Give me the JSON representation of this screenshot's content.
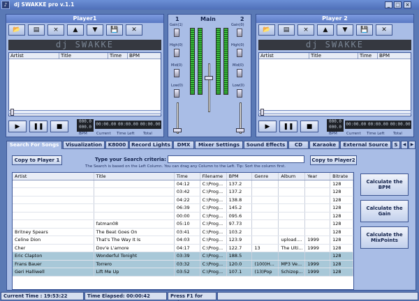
{
  "window": {
    "title": "dj SWAKKE pro   v.1.1"
  },
  "player1": {
    "title": "Player1",
    "display": "dj SWAKKE",
    "columns": [
      "Artist",
      "Title",
      "Time",
      "BPM"
    ],
    "bpm_top": "000.0",
    "bpm_bottom": "000.0",
    "current": "00:00.00",
    "time_left": "00:00.00",
    "total": "00:00.00",
    "bpm_label": "BPM",
    "current_label": "Current",
    "time_left_label": "Time Left",
    "total_label": "Total"
  },
  "player2": {
    "title": "Player 2",
    "display": "dj SWAKKE",
    "columns": [
      "Artist",
      "Title",
      "Time",
      "BPM"
    ],
    "bpm_top": "000.0",
    "bpm_bottom": "000.0",
    "current": "00:00.00",
    "time_left": "00:00.00",
    "total": "00:00.00",
    "bpm_label": "BPM",
    "current_label": "Current",
    "time_left_label": "Time Left",
    "total_label": "Total"
  },
  "mixer": {
    "title": "Main",
    "left_num": "1",
    "right_num": "2",
    "gain1": "Gain(1)",
    "gain0": "Gain(0)",
    "high": "High(0)",
    "mid": "Mid(0)",
    "low": "Low(0)"
  },
  "tabs": [
    "Search For Songs",
    "Visualization",
    "K8000",
    "Record Lights",
    "DMX",
    "Mixer Settings",
    "Sound Effects",
    "CD",
    "Karaoke",
    "External Source",
    "S"
  ],
  "search": {
    "copy1": "Copy to Player 1",
    "copy2": "Copy to Player2",
    "criteria_label": "Type your Search criteria:",
    "hint": "The Search is based on the Left Column. You can drag any Column to the Left. Tip: Sort the column first."
  },
  "table": {
    "columns": [
      "Artist",
      "Title",
      "Time",
      "Filename",
      "BPM",
      "Genre",
      "Album",
      "Year",
      "Bitrate"
    ],
    "rows": [
      [
        "",
        "",
        "04:12",
        "C:\\Prog...",
        "137.2",
        "",
        "",
        "",
        "128"
      ],
      [
        "",
        "",
        "03:42",
        "C:\\Prog...",
        "137.2",
        "",
        "",
        "",
        "128"
      ],
      [
        "",
        "",
        "04:22",
        "C:\\Prog...",
        "138.8",
        "",
        "",
        "",
        "128"
      ],
      [
        "",
        "",
        "06:39",
        "C:\\Prog...",
        "145.2",
        "",
        "",
        "",
        "128"
      ],
      [
        "",
        "",
        "00:00",
        "C:\\Prog...",
        "095.6",
        "",
        "",
        "",
        "128"
      ],
      [
        "",
        "fatman08",
        "05:10",
        "C:\\Prog...",
        "97.73",
        "",
        "",
        "",
        "128"
      ],
      [
        "Britney Spears",
        "The Beat Goes On",
        "03:41",
        "C:\\Prog...",
        "103.2",
        "",
        "",
        "",
        "128"
      ],
      [
        "Celine Dion",
        "That's The Way It Is",
        "04:03",
        "C:\\Prog...",
        "123.9",
        "",
        "upload....",
        "1999",
        "128"
      ],
      [
        "Cher",
        "Dov'e L'amore",
        "04:17",
        "C:\\Prog...",
        "122.7",
        "13",
        "The Ulti...",
        "1999",
        "128"
      ],
      [
        "Eric Clapton",
        "Wonderful Tonight",
        "03:39",
        "C:\\Prog...",
        "188.5",
        "",
        "",
        "",
        "128"
      ],
      [
        "Frans Bauer",
        "Torrero",
        "03:32",
        "C:\\Prog...",
        "120.0",
        "(100)H...",
        "MP3 Ve...",
        "1999",
        "128"
      ],
      [
        "Geri Halliwell",
        "Lift Me Up",
        "03:52",
        "C:\\Prog...",
        "107.1",
        "(13)Pop",
        "Schizop...",
        "1999",
        "128"
      ]
    ],
    "selected_rows": [
      9,
      10,
      11
    ]
  },
  "side_buttons": {
    "bpm": "Calculate the BPM",
    "gain": "Calculate the Gain",
    "mix": "Calculate the MixPoints"
  },
  "status": {
    "current_time": "Current Time : 19:53:22",
    "elapsed": "Time Elapsed: 00:00:42",
    "help": "Press F1 for Help"
  }
}
